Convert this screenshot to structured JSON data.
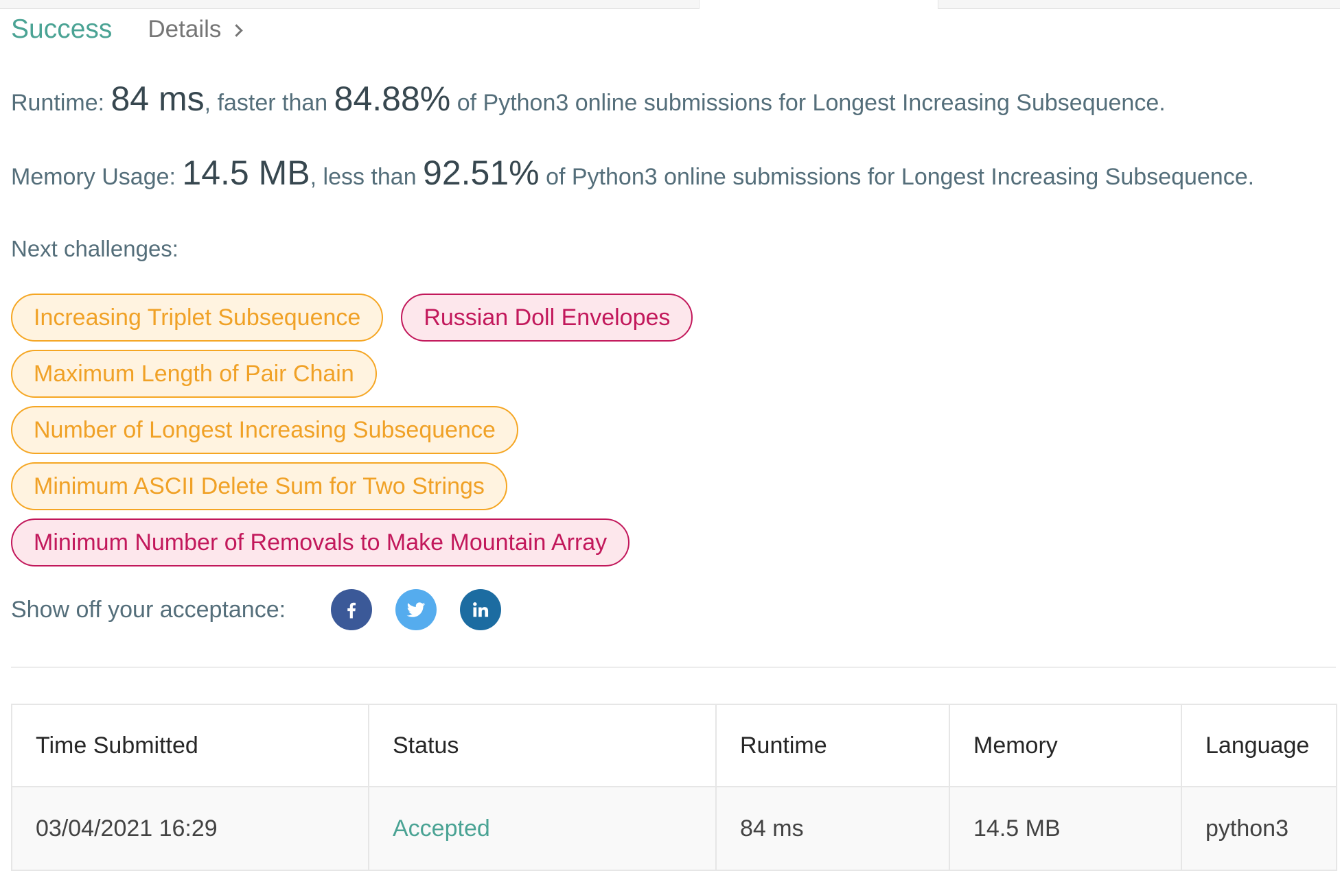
{
  "colors": {
    "success": "#4aa394",
    "medium_chip_text": "#f0a126",
    "medium_chip_border": "#f5a623",
    "medium_chip_bg": "#fff3e0",
    "hard_chip_text": "#c2185b",
    "hard_chip_bg": "#fde7ec",
    "facebook": "#3b5998",
    "twitter": "#55acee",
    "linkedin": "#1c6ca1"
  },
  "header": {
    "status": "Success",
    "details_label": "Details",
    "details_icon": "chevron-right-icon"
  },
  "runtime_line": {
    "label": "Runtime: ",
    "value": "84 ms",
    "comparison": ", faster than ",
    "percent": "84.88%",
    "suffix": " of Python3 online submissions for Longest Increasing Subsequence."
  },
  "memory_line": {
    "label": "Memory Usage: ",
    "value": "14.5 MB",
    "comparison": ", less than ",
    "percent": "92.51%",
    "suffix": " of Python3 online submissions for Longest Increasing Subsequence."
  },
  "next_challenges": {
    "label": "Next challenges:",
    "items": [
      {
        "label": "Increasing Triplet Subsequence",
        "difficulty": "medium"
      },
      {
        "label": "Russian Doll Envelopes",
        "difficulty": "hard"
      },
      {
        "label": "Maximum Length of Pair Chain",
        "difficulty": "medium"
      },
      {
        "label": "Number of Longest Increasing Subsequence",
        "difficulty": "medium"
      },
      {
        "label": "Minimum ASCII Delete Sum for Two Strings",
        "difficulty": "medium"
      },
      {
        "label": "Minimum Number of Removals to Make Mountain Array",
        "difficulty": "hard"
      }
    ]
  },
  "share": {
    "label": "Show off your acceptance:",
    "icons": [
      "facebook-icon",
      "twitter-icon",
      "linkedin-icon"
    ]
  },
  "submissions": {
    "columns": [
      "Time Submitted",
      "Status",
      "Runtime",
      "Memory",
      "Language"
    ],
    "rows": [
      [
        "03/04/2021 16:29",
        "Accepted",
        "84 ms",
        "14.5 MB",
        "python3"
      ]
    ]
  }
}
